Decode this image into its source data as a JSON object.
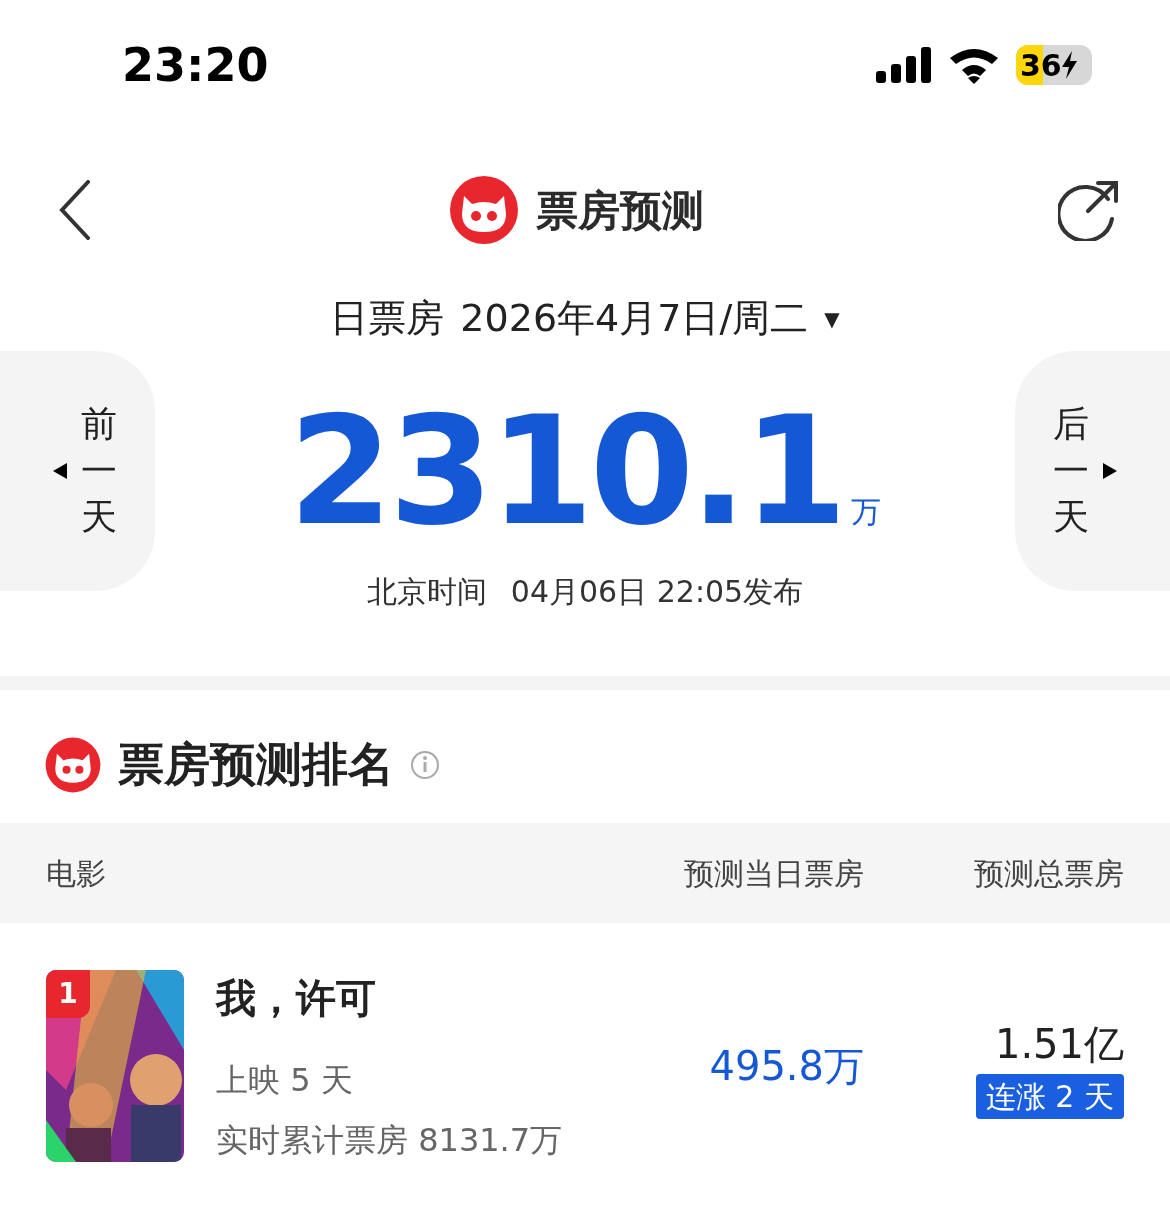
{
  "status_bar": {
    "time": "23:20",
    "battery": "36"
  },
  "nav": {
    "title": "票房预测"
  },
  "date_selector": {
    "label": "日票房",
    "date": "2026年4月7日/周二",
    "caret": "▼"
  },
  "prev_day": {
    "label": "前一天"
  },
  "next_day": {
    "label": "后一天"
  },
  "total": {
    "value": "2310.1",
    "unit": "万"
  },
  "publish": {
    "prefix": "北京时间",
    "time": "04月06日 22:05发布"
  },
  "section": {
    "title": "票房预测排名"
  },
  "table": {
    "columns": [
      "电影",
      "预测当日票房",
      "预测总票房"
    ],
    "rows": [
      {
        "rank": "1",
        "kind": "picture",
        "title": "我，许可",
        "days": "上映 5 天",
        "cumulative": "实时累计票房 8131.7万",
        "day_forecast": "495.8万",
        "total_forecast": "1.51亿",
        "tag": "连涨 2 天"
      }
    ]
  }
}
